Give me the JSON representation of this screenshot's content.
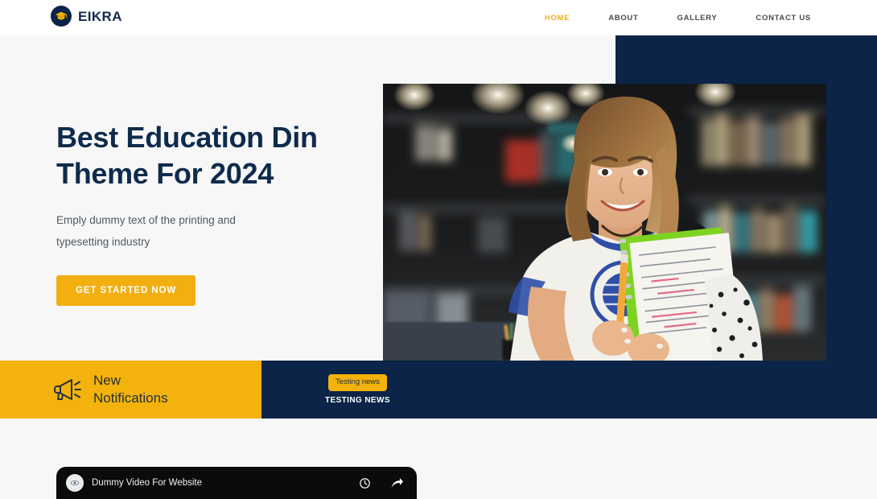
{
  "header": {
    "brand_name": "EIKRA",
    "brand_icon": "graduation-cap-icon",
    "nav": [
      {
        "label": "HOME",
        "active": true
      },
      {
        "label": "ABOUT",
        "active": false
      },
      {
        "label": "GALLERY",
        "active": false
      },
      {
        "label": "CONTACT US",
        "active": false
      }
    ]
  },
  "hero": {
    "title_line1": "Best Education Din",
    "title_line2": "Theme For 2024",
    "subtitle": "Emply dummy text of the printing and typesetting industry",
    "cta_label": "GET STARTED NOW",
    "photo_alt": "Smiling female student holding notebooks in a library"
  },
  "notifications": {
    "icon": "megaphone-icon",
    "title_line1": "New",
    "title_line2": "Notifications",
    "badge_label": "Testing news",
    "headline": "TESTING NEWS"
  },
  "video": {
    "title": "Dummy Video For Website",
    "watch_later_icon": "clock-icon",
    "share_icon": "share-arrow-icon",
    "avatar_icon": "channel-avatar-icon"
  },
  "colors": {
    "navy": "#0b2447",
    "yellow": "#f3b20c",
    "accent": "#f0ad1e",
    "page_bg": "#f7f7f7",
    "header_bg": "#ffffff"
  }
}
